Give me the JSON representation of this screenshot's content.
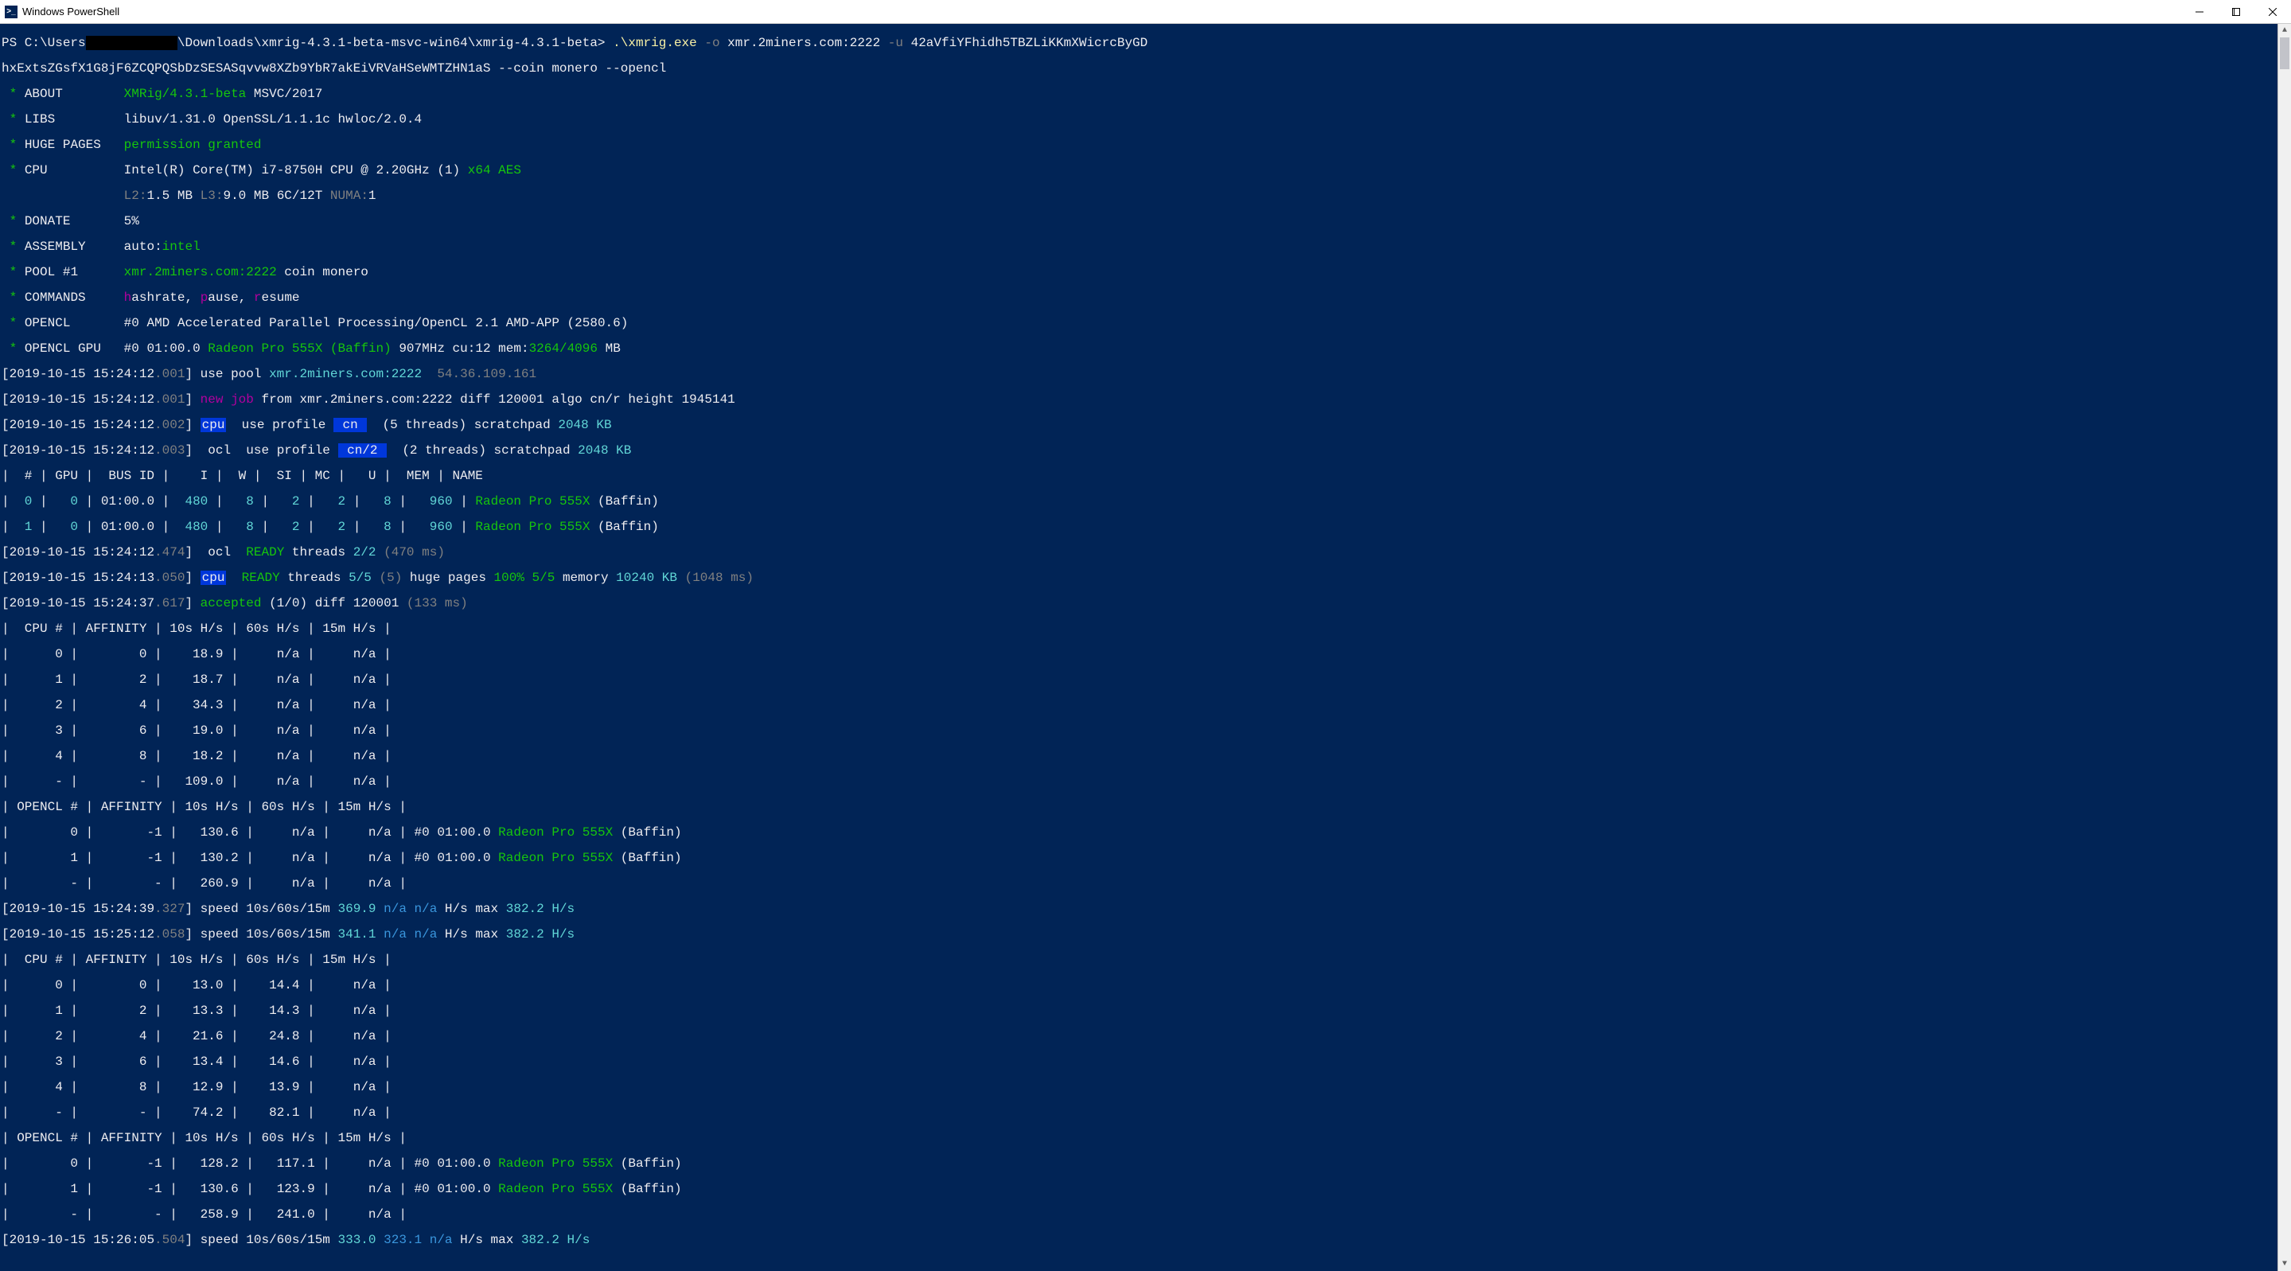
{
  "window": {
    "title": "Windows PowerShell",
    "icon_label": ">_"
  },
  "cmd": {
    "prompt_pre": "PS C:\\Users",
    "prompt_post": "\\Downloads\\xmrig-4.3.1-beta-msvc-win64\\xmrig-4.3.1-beta> ",
    "exe": ".\\xmrig.exe ",
    "arg_o": "-o",
    "pool_arg": " xmr.2miners.com:2222 ",
    "arg_u": "-u",
    "wallet1": " 42aVfiYFhidh5TBZLiKKmXWicrcByGD",
    "wallet2": "hxExtsZGsfX1G8jF6ZCQPQSbDzSESASqvvw8XZb9YbR7akEiVRVaHSeWMTZHN1aS --coin monero --opencl"
  },
  "about": {
    "label": "ABOUT",
    "val1": "XMRig/4.3.1-beta",
    "val2": " MSVC/2017"
  },
  "libs": {
    "label": "LIBS",
    "val": "libuv/1.31.0 OpenSSL/1.1.1c hwloc/2.0.4"
  },
  "huge": {
    "label": "HUGE PAGES",
    "val": "permission granted"
  },
  "cpu": {
    "label": "CPU",
    "model": "Intel(R) Core(TM) i7-8750H CPU @ 2.20GHz (1) ",
    "feat": "x64 AES",
    "l2lbl": "L2:",
    "l2": "1.5 MB ",
    "l3lbl": "L3:",
    "l3": "9.0 MB ",
    "cores": "6C/12T ",
    "numalbl": "NUMA:",
    "numa": "1"
  },
  "donate": {
    "label": "DONATE",
    "val": "5%"
  },
  "assembly": {
    "label": "ASSEMBLY",
    "val1": "auto:",
    "val2": "intel"
  },
  "pool": {
    "label": "POOL #1",
    "val1": "xmr.2miners.com:2222",
    "val2": " coin monero"
  },
  "commands": {
    "label": "COMMANDS",
    "h": "h",
    "r1": "ashrate, ",
    "p": "p",
    "r2": "ause, ",
    "r": "r",
    "r3": "esume"
  },
  "opencl": {
    "label": "OPENCL",
    "val1": "#0",
    "val2": " AMD Accelerated Parallel Processing/OpenCL 2.1 AMD-APP (2580.6)"
  },
  "gpu": {
    "label": "OPENCL GPU",
    "val1": "#0",
    "val2": " 01:00.0 ",
    "name": "Radeon Pro 555X (Baffin) ",
    "freq": "907MHz cu:12 mem:",
    "mem": "3264/4096",
    "end": " MB"
  },
  "log": [
    {
      "ts": "2019-10-15 15:24:12",
      "ms": ".001",
      "t": "usepool",
      "pool": "xmr.2miners.com:2222  ",
      "ip": "54.36.109.161"
    },
    {
      "ts": "2019-10-15 15:24:12",
      "ms": ".001",
      "t": "newjob",
      "rest": " from xmr.2miners.com:2222 diff 120001 algo cn/r height 1945141"
    },
    {
      "ts": "2019-10-15 15:24:12",
      "ms": ".002",
      "t": "profile",
      "tag": "cpu",
      "p": " cn ",
      "rest1": "  (5 threads) scratchpad ",
      "kb": "2048 KB"
    },
    {
      "ts": "2019-10-15 15:24:12",
      "ms": ".003",
      "t": "profile",
      "tag": "ocl",
      "p": " cn/2 ",
      "rest1": "  (2 threads) scratchpad ",
      "kb": "2048 KB"
    }
  ],
  "gputable": {
    "header": "|  # | GPU |  BUS ID |    I |  W |  SI | MC |   U |  MEM | NAME",
    "rows": [
      {
        "idx": " 0",
        "gpu": "  0",
        "bus": "01:00.0",
        "i": " 480",
        "w": "  8",
        "si": "  2",
        "mc": "  2",
        "u": "  8",
        "mem": "  960",
        "name": "Radeon Pro 555X ",
        "baffin": "(Baffin)"
      },
      {
        "idx": " 1",
        "gpu": "  0",
        "bus": "01:00.0",
        "i": " 480",
        "w": "  8",
        "si": "  2",
        "mc": "  2",
        "u": "  8",
        "mem": "  960",
        "name": "Radeon Pro 555X ",
        "baffin": "(Baffin)"
      }
    ]
  },
  "ready": [
    {
      "ts": "2019-10-15 15:24:12",
      "ms": ".474",
      "tag": "ocl",
      "txt1": "READY ",
      "txt2": "threads ",
      "n": "2/2 ",
      "extra": "(470 ms)"
    },
    {
      "ts": "2019-10-15 15:24:13",
      "ms": ".050",
      "tag": "cpu",
      "txt1": "READY ",
      "txt2": "threads ",
      "n": "5/5 ",
      "paren": "(5) ",
      "hp": "huge pages ",
      "hpv": "100% 5/5 ",
      "mem": "memory ",
      "memv": "10240 KB ",
      "extra": "(1048 ms)"
    }
  ],
  "accepted": {
    "ts": "2019-10-15 15:24:37",
    "ms": ".617",
    "lbl": "accepted ",
    "cnt": "(1/0) diff 120001 ",
    "extra": "(133 ms)"
  },
  "hash1": {
    "cpu_hdr": "|  CPU # | AFFINITY | 10s H/s | 60s H/s | 15m H/s |",
    "cpu_rows": [
      {
        "c": "     0",
        "a": "       0",
        "s10": "   18.9",
        "s60": "    n/a",
        "s15": "    n/a"
      },
      {
        "c": "     1",
        "a": "       2",
        "s10": "   18.7",
        "s60": "    n/a",
        "s15": "    n/a"
      },
      {
        "c": "     2",
        "a": "       4",
        "s10": "   34.3",
        "s60": "    n/a",
        "s15": "    n/a"
      },
      {
        "c": "     3",
        "a": "       6",
        "s10": "   19.0",
        "s60": "    n/a",
        "s15": "    n/a"
      },
      {
        "c": "     4",
        "a": "       8",
        "s10": "   18.2",
        "s60": "    n/a",
        "s15": "    n/a"
      },
      {
        "c": "     -",
        "a": "       -",
        "s10": "  109.0",
        "s60": "    n/a",
        "s15": "    n/a"
      }
    ],
    "ocl_hdr": "| OPENCL # | AFFINITY | 10s H/s | 60s H/s | 15m H/s |",
    "ocl_rows": [
      {
        "c": "       0",
        "a": "      -1",
        "s10": "  130.6",
        "s60": "    n/a",
        "s15": "    n/a",
        "g": " #0 01:00.0 ",
        "n": "Radeon Pro 555X ",
        "b": "(Baffin)"
      },
      {
        "c": "       1",
        "a": "      -1",
        "s10": "  130.2",
        "s60": "    n/a",
        "s15": "    n/a",
        "g": " #0 01:00.0 ",
        "n": "Radeon Pro 555X ",
        "b": "(Baffin)"
      },
      {
        "c": "       -",
        "a": "       -",
        "s10": "  260.9",
        "s60": "    n/a",
        "s15": "    n/a"
      }
    ]
  },
  "speed": [
    {
      "ts": "2019-10-15 15:24:39",
      "ms": ".327",
      "pre": " speed 10s/60s/15m ",
      "v1": "369.9 ",
      "v2": "n/a ",
      "v3": "n/a ",
      "hs": "H/s ",
      "max": "max ",
      "mv": "382.2 H/s"
    },
    {
      "ts": "2019-10-15 15:25:12",
      "ms": ".058",
      "pre": " speed 10s/60s/15m ",
      "v1": "341.1 ",
      "v2": "n/a ",
      "v3": "n/a ",
      "hs": "H/s ",
      "max": "max ",
      "mv": "382.2 H/s"
    }
  ],
  "hash2": {
    "cpu_hdr": "|  CPU # | AFFINITY | 10s H/s | 60s H/s | 15m H/s |",
    "cpu_rows": [
      {
        "c": "     0",
        "a": "       0",
        "s10": "   13.0",
        "s60": "   14.4",
        "s15": "    n/a"
      },
      {
        "c": "     1",
        "a": "       2",
        "s10": "   13.3",
        "s60": "   14.3",
        "s15": "    n/a"
      },
      {
        "c": "     2",
        "a": "       4",
        "s10": "   21.6",
        "s60": "   24.8",
        "s15": "    n/a"
      },
      {
        "c": "     3",
        "a": "       6",
        "s10": "   13.4",
        "s60": "   14.6",
        "s15": "    n/a"
      },
      {
        "c": "     4",
        "a": "       8",
        "s10": "   12.9",
        "s60": "   13.9",
        "s15": "    n/a"
      },
      {
        "c": "     -",
        "a": "       -",
        "s10": "   74.2",
        "s60": "   82.1",
        "s15": "    n/a"
      }
    ],
    "ocl_hdr": "| OPENCL # | AFFINITY | 10s H/s | 60s H/s | 15m H/s |",
    "ocl_rows": [
      {
        "c": "       0",
        "a": "      -1",
        "s10": "  128.2",
        "s60": "  117.1",
        "s15": "    n/a",
        "g": " #0 01:00.0 ",
        "n": "Radeon Pro 555X ",
        "b": "(Baffin)"
      },
      {
        "c": "       1",
        "a": "      -1",
        "s10": "  130.6",
        "s60": "  123.9",
        "s15": "    n/a",
        "g": " #0 01:00.0 ",
        "n": "Radeon Pro 555X ",
        "b": "(Baffin)"
      },
      {
        "c": "       -",
        "a": "       -",
        "s10": "  258.9",
        "s60": "  241.0",
        "s15": "    n/a"
      }
    ]
  },
  "speed3": {
    "ts": "2019-10-15 15:26:05",
    "ms": ".504",
    "pre": " speed 10s/60s/15m ",
    "v1": "333.0 ",
    "v2": "323.1 ",
    "v3": "n/a ",
    "hs": "H/s ",
    "max": "max ",
    "mv": "382.2 H/s"
  }
}
